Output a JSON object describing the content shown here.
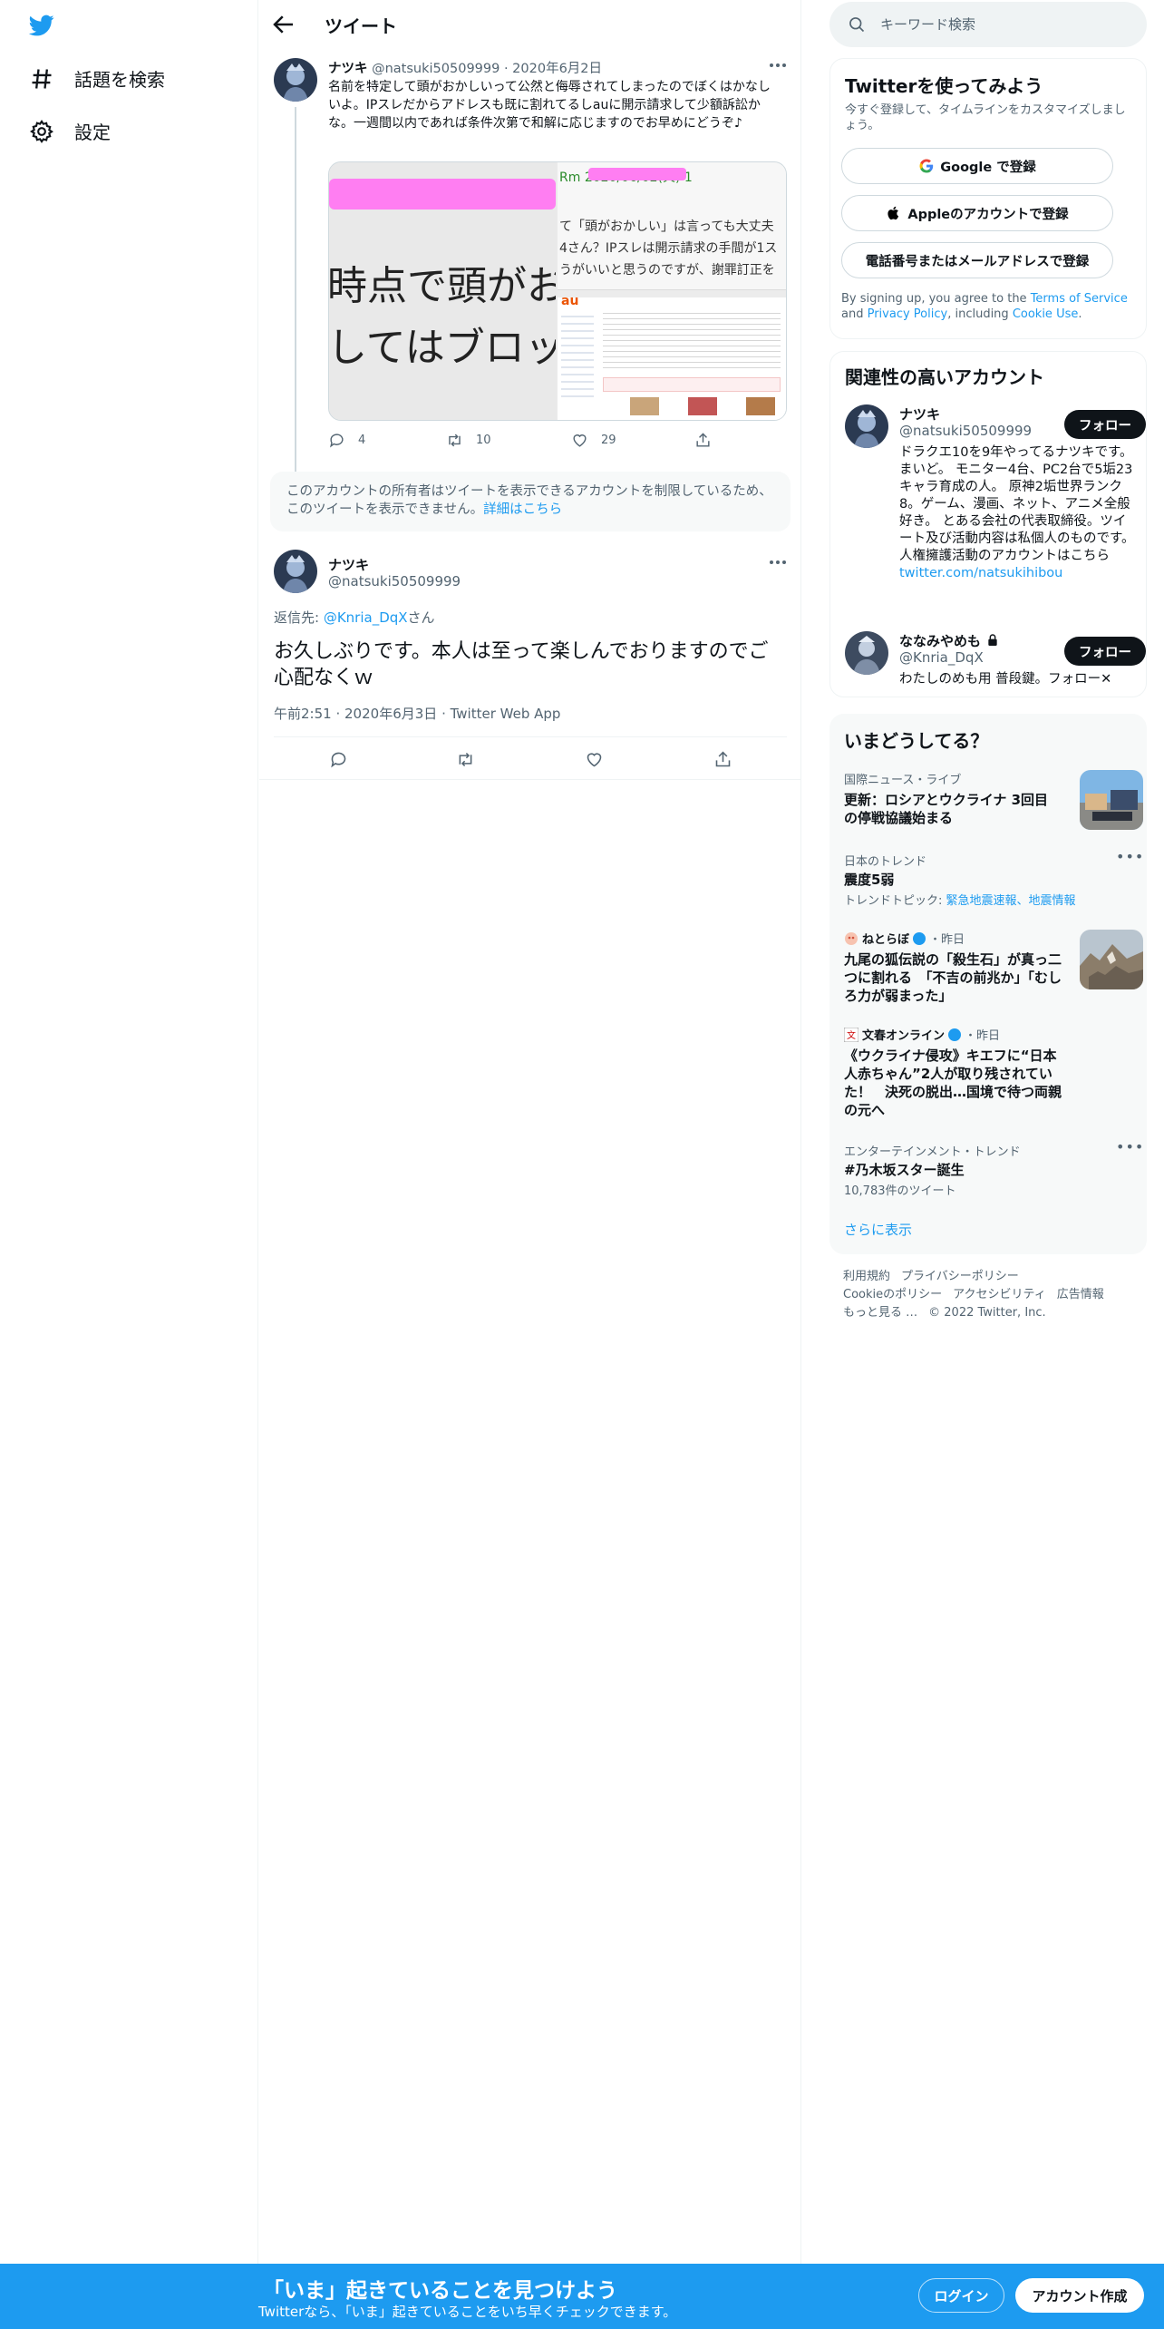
{
  "nav": {
    "explore_label": "話題を検索",
    "settings_label": "設定"
  },
  "main": {
    "title": "ツイート"
  },
  "quoted_tweet": {
    "name": "ナツキ",
    "handle": "@natsuki50509999",
    "date": "2020年6月2日",
    "text": "名前を特定して頭がおかしいって公然と侮辱されてしまったのでぼくはかなしいよ。IPスレだからアドレスも既に割れてるしauに開示請求して少額訴訟かな。一週間以内であれば条件次第で和解に応じますのでお早めにどうぞ♪",
    "media": {
      "left_line1": "時点で頭がお",
      "left_line2": "してはブロッ",
      "right_header": "Rm 2020/06/02(火) 1",
      "right_line1": "て「頭がおかしい」は言っても大丈夫",
      "right_line2": "4さん？IPスレは開示請求の手間が1ス",
      "right_line3": "うがいいと思うのですが、謝罪訂正を",
      "au_logo": "au"
    },
    "replies": "4",
    "retweets": "10",
    "likes": "29"
  },
  "restricted_notice": {
    "text": "このアカウントの所有者はツイートを表示できるアカウントを制限しているため、このツイートを表示できません。",
    "link": "詳細はこちら"
  },
  "main_tweet": {
    "name": "ナツキ",
    "handle": "@natsuki50509999",
    "reply_prefix": "返信先: ",
    "reply_to": "@Knria_DqX",
    "reply_suffix": "さん",
    "text": "お久しぶりです。本人は至って楽しんでおりますのでご心配なくｗ",
    "time": "午前2:51",
    "date": "2020年6月3日",
    "source": "Twitter Web App"
  },
  "search": {
    "placeholder": "キーワード検索"
  },
  "signup_panel": {
    "title": "Twitterを使ってみよう",
    "subtitle": "今すぐ登録して、タイムラインをカスタマイズしましょう。",
    "google_label": "Google で登録",
    "apple_label": "Appleのアカウントで登録",
    "phone_label": "電話番号またはメールアドレスで登録",
    "terms_prefix": "By signing up, you agree to the ",
    "terms_link": "Terms of Service",
    "terms_and": " and ",
    "privacy_link": "Privacy Policy",
    "terms_including": ", including ",
    "cookie_link": "Cookie Use",
    "terms_end": "."
  },
  "relevant_accounts": {
    "title": "関連性の高いアカウント",
    "follow_label": "フォロー",
    "accounts": [
      {
        "name": "ナツキ",
        "handle": "@natsuki50509999",
        "bio": "ドラクエ10を9年やってるナツキです。まいど。 モニター4台、PC2台で5垢23キャラ育成の人。 原神2垢世界ランク8。ゲーム、漫画、ネット、アニメ全般好き。 とある会社の代表取締役。ツイート及び活動内容は私個人のものです。 人権擁護活動のアカウントはこちら",
        "link": "twitter.com/natsukihibou"
      },
      {
        "name": "ななみやめも",
        "handle": "@Knria_DqX",
        "bio": "わたしのめも用 普段鍵。フォロー✕"
      }
    ]
  },
  "trends": {
    "title": "いまどうしてる？",
    "items": [
      {
        "context": "国際ニュース・ライブ",
        "title": "更新：ロシアとウクライナ 3回目の停戦協議始まる"
      },
      {
        "context": "日本のトレンド",
        "title": "震度5弱",
        "sub_prefix": "トレンドトピック: ",
        "sub_link": "緊急地震速報、地震情報"
      },
      {
        "context_name": "ねとらぼ",
        "context_time": "・昨日",
        "title": "九尾の狐伝説の「殺生石」が真っ二つに割れる　「不吉の前兆か」「むしろ力が弱まった」"
      },
      {
        "context_name": "文春オンライン",
        "context_time": "・昨日",
        "title": "《ウクライナ侵攻》キエフに“日本人赤ちゃん”2人が取り残されていた！　決死の脱出…国境で待つ両親の元へ"
      },
      {
        "context": "エンターテインメント・トレンド",
        "title": "#乃木坂スター誕生",
        "sub": "10,783件のツイート"
      }
    ],
    "show_more": "さらに表示"
  },
  "footer": {
    "links": [
      "利用規約",
      "プライバシーポリシー",
      "Cookieのポリシー",
      "アクセシビリティ",
      "広告情報",
      "もっと見る …"
    ],
    "copyright": "© 2022 Twitter, Inc."
  },
  "bottom_bar": {
    "title": "「いま」起きていることを見つけよう",
    "subtitle": "Twitterなら、「いま」起きていることをいち早くチェックできます。",
    "login_label": "ログイン",
    "signup_label": "アカウント作成"
  },
  "colors": {
    "brand": "#1d9bf0",
    "text": "#0f1419",
    "muted": "#536471",
    "redaction": "#ff7ef2"
  }
}
